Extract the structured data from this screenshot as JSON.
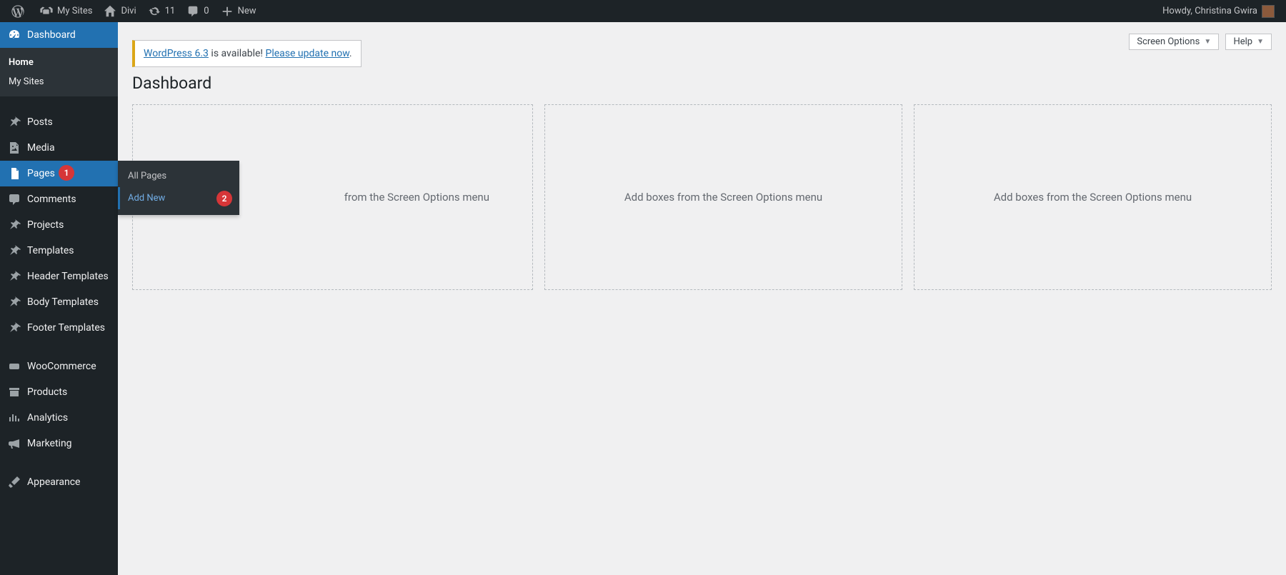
{
  "adminbar": {
    "my_sites": "My Sites",
    "site_name": "Divi",
    "updates_count": "11",
    "comments_count": "0",
    "new_label": "New",
    "howdy_prefix": "Howdy, ",
    "user_name": "Christina Gwira"
  },
  "sidebar": {
    "dashboard": {
      "label": "Dashboard",
      "home": "Home",
      "my_sites": "My Sites"
    },
    "posts": "Posts",
    "media": "Media",
    "pages": "Pages",
    "comments": "Comments",
    "projects": "Projects",
    "templates": "Templates",
    "header_templates": "Header Templates",
    "body_templates": "Body Templates",
    "footer_templates": "Footer Templates",
    "woocommerce": "WooCommerce",
    "products": "Products",
    "analytics": "Analytics",
    "marketing": "Marketing",
    "appearance": "Appearance"
  },
  "flyout": {
    "all_pages": "All Pages",
    "add_new": "Add New"
  },
  "annotations": {
    "badge1": "1",
    "badge2": "2"
  },
  "content": {
    "screen_options": "Screen Options",
    "help": "Help",
    "notice_link1": "WordPress 6.3",
    "notice_mid": " is available! ",
    "notice_link2": "Please update now",
    "notice_end": ".",
    "page_title": "Dashboard",
    "box_text": "Add boxes from the Screen Options menu",
    "box1_text": "from the Screen Options menu"
  }
}
